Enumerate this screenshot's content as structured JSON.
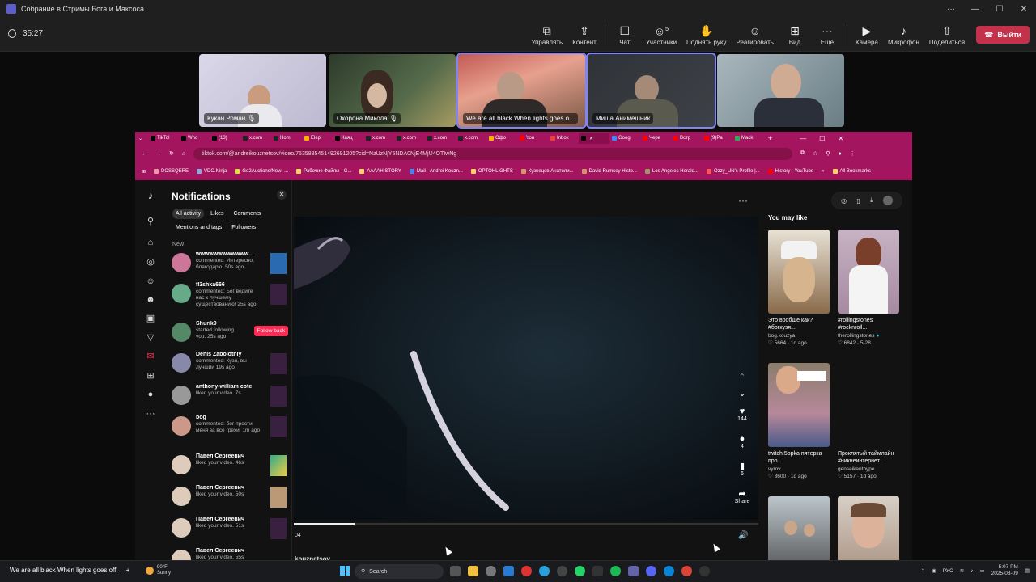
{
  "teams": {
    "window_title": "Собрание в Стримы Бога и Максоса",
    "timer": "35:27",
    "tools": [
      {
        "icon": "share-screen-icon",
        "label": "Управлять"
      },
      {
        "icon": "content-icon",
        "label": "Контент"
      },
      {
        "icon": "chat-icon",
        "label": "Чат"
      },
      {
        "icon": "participants-icon",
        "label": "Участники",
        "count": "5"
      },
      {
        "icon": "raise-hand-icon",
        "label": "Поднять руку"
      },
      {
        "icon": "react-icon",
        "label": "Реагировать"
      },
      {
        "icon": "view-icon",
        "label": "Вид"
      },
      {
        "icon": "more-icon",
        "label": "Еще"
      },
      {
        "icon": "camera-icon",
        "label": "Камера"
      },
      {
        "icon": "mic-icon",
        "label": "Микрофон"
      },
      {
        "icon": "share-icon",
        "label": "Поделиться"
      }
    ],
    "leave_label": "Выйти",
    "participants": [
      {
        "name": "Кукан Роман"
      },
      {
        "name": "Охорона Микола"
      },
      {
        "name": "We are all black When lights goes o..."
      },
      {
        "name": "Миша Анимешник"
      },
      {
        "name": ""
      }
    ]
  },
  "browser": {
    "tabs": [
      "TikTol",
      "Who",
      "(13)",
      "x.com",
      "Hom",
      "Elepl",
      "Каяц",
      "x.com",
      "x.com",
      "x.com",
      "x.com",
      "Офо",
      "You",
      "Inbox",
      "",
      "Goog",
      "Чере",
      "Встр",
      "(9)Pa",
      "Mack"
    ],
    "url": "tiktok.com/@andreikouznetsov/video/7535885451492691205?cid=NzUzNjY5NDA0NjE4MjU4OTIwNg",
    "bookmarks": [
      "DOSSQERE",
      "VDO.Ninja",
      "Go2Auctions/Now -...",
      "Рабочие Файлы - G...",
      "AAAAHISTORY",
      "Mail - Andrei Kouzn...",
      "OPTOHLIGHTS",
      "Кузнецов Анатоли...",
      "David Rumsey Histo...",
      "Los Angeles Herald...",
      "Ozzy_UN's Profile |...",
      "History - YouTube"
    ],
    "all_bookmarks": "All Bookmarks"
  },
  "tiktok": {
    "notifications_title": "Notifications",
    "chips": [
      "All activity",
      "Likes",
      "Comments",
      "Mentions and tags",
      "Followers"
    ],
    "new_label": "New",
    "notifications": [
      {
        "name": "wwwwwwwwwwww...",
        "text": "commented: Интересно, благодарю!",
        "time": "50s ago"
      },
      {
        "name": "fl3shka666",
        "text": "commented: Бог ведите нас к лучшему существованию!",
        "time": "25s ago"
      },
      {
        "name": "Shurik9",
        "text": "started following you.",
        "time": "25s ago"
      },
      {
        "name": "Denis Zabolotniy",
        "text": "commented: Кузя, вы лучший",
        "time": "19s ago"
      },
      {
        "name": "anthony-william cote",
        "text": "liked your video.",
        "time": "7s"
      },
      {
        "name": "bog",
        "text": "commented: бог прости меня за все грехи!",
        "time": "1m ago"
      },
      {
        "name": "Павел Сергеевич",
        "text": "liked your video.",
        "time": "46s"
      },
      {
        "name": "Павел Сергеевич",
        "text": "liked your video.",
        "time": "50s"
      },
      {
        "name": "Павел Сергеевич",
        "text": "liked your video.",
        "time": "51s"
      },
      {
        "name": "Павел Сергеевич",
        "text": "liked your video.",
        "time": "55s"
      }
    ],
    "follow_back": "Follow back",
    "likes": "144",
    "comments": "4",
    "saves": "6",
    "share": "Share",
    "time_label": "04",
    "author_partial": "kouznetsov",
    "progress": 0.13,
    "you_may_like": "You may like",
    "cards": [
      {
        "title": "Это вообще как? #богкузя...",
        "user": "bog.kouzya",
        "likes": "5664",
        "date": "1d ago"
      },
      {
        "title": "#rollingstones #rocknroll...",
        "user": "therollingstones",
        "likes": "6842",
        "date": "5-28"
      },
      {
        "title": "twitch:5opka пятерка про...",
        "user": "vyrov",
        "likes": "3600",
        "date": "1d ago"
      },
      {
        "title": "Проклятый таймлайн #никнеинтернет...",
        "user": "genseikanthype",
        "likes": "5157",
        "date": "1d ago"
      }
    ]
  },
  "taskbar": {
    "now_playing": "We are all black When lights goes off.",
    "temperature": "90°F",
    "condition": "Sunny",
    "search": "Search",
    "lang": "РУС",
    "time": "5:07 PM",
    "date": "2025-08-09"
  }
}
